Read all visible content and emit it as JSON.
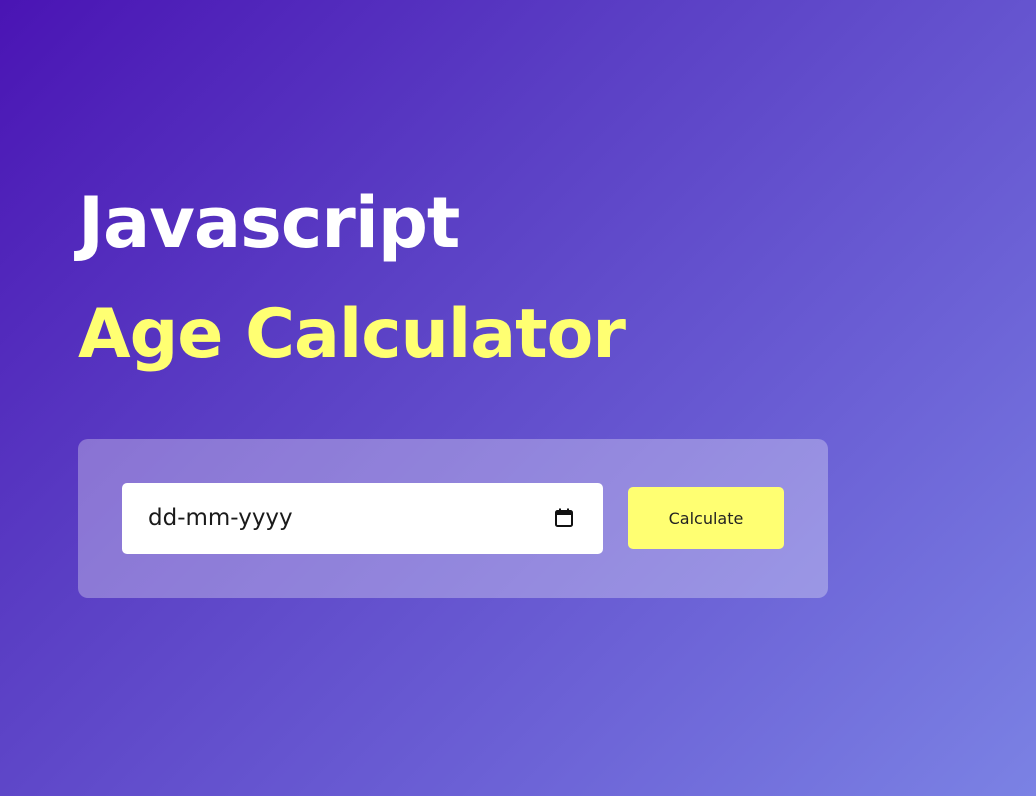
{
  "header": {
    "title_line1": "Javascript",
    "title_line2": "Age Calculator"
  },
  "form": {
    "date_placeholder": "dd-mm-yyyy",
    "date_value": "",
    "calendar_icon": "calendar-icon",
    "calculate_label": "Calculate"
  },
  "colors": {
    "gradient_start": "#4a14b4",
    "gradient_end": "#7b82e4",
    "accent_yellow": "#ffff72",
    "title_white": "#ffffff"
  }
}
